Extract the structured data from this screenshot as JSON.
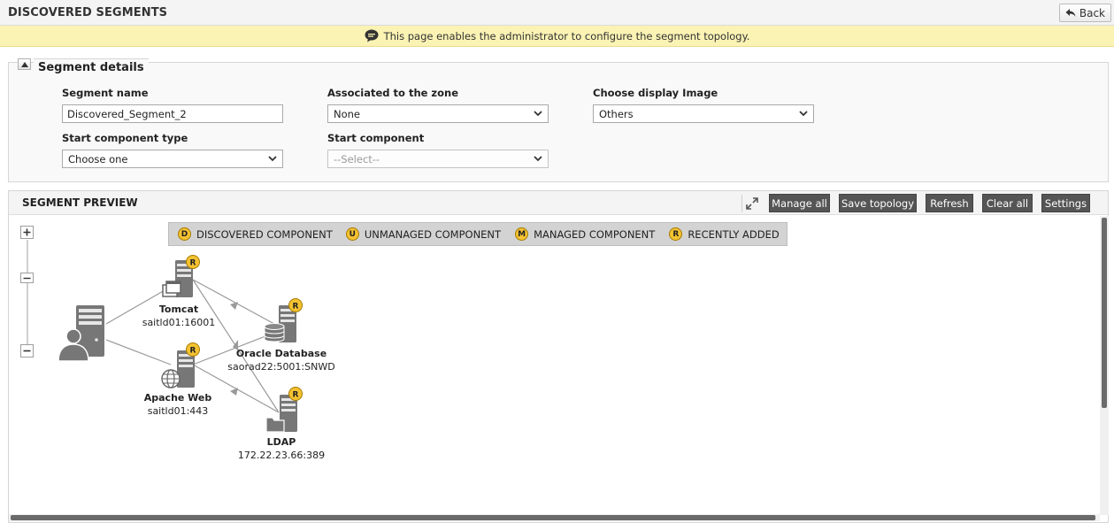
{
  "header": {
    "title": "DISCOVERED SEGMENTS",
    "back_label": "Back"
  },
  "banner": {
    "message": "This page enables the administrator to configure the segment topology."
  },
  "details": {
    "legend": "Segment details",
    "segment_name_label": "Segment name",
    "segment_name_value": "Discovered_Segment_2",
    "zone_label": "Associated to the zone",
    "zone_value": "None",
    "display_image_label": "Choose display Image",
    "display_image_value": "Others",
    "start_type_label": "Start component type",
    "start_type_value": "Choose one",
    "start_component_label": "Start component",
    "start_component_value": "--Select--"
  },
  "preview": {
    "title": "SEGMENT PREVIEW",
    "buttons": {
      "manage_all": "Manage all",
      "save_topology": "Save topology",
      "refresh": "Refresh",
      "clear_all": "Clear all",
      "settings": "Settings"
    },
    "legend": [
      {
        "badge": "D",
        "label": "DISCOVERED COMPONENT"
      },
      {
        "badge": "U",
        "label": "UNMANAGED COMPONENT"
      },
      {
        "badge": "M",
        "label": "MANAGED COMPONENT"
      },
      {
        "badge": "R",
        "label": "RECENTLY ADDED"
      }
    ],
    "nodes": {
      "tomcat": {
        "name": "Tomcat",
        "address": "saitld01:16001",
        "badge": "R"
      },
      "oracle": {
        "name": "Oracle Database",
        "address": "saorad22:5001:SNWD",
        "badge": "R"
      },
      "apache": {
        "name": "Apache Web",
        "address": "saitld01:443",
        "badge": "R"
      },
      "ldap": {
        "name": "LDAP",
        "address": "172.22.23.66:389",
        "badge": "R"
      }
    }
  },
  "colors": {
    "banner_bg": "#fbf3b4",
    "button_bg": "#555555",
    "badge_bg": "#f4c231",
    "icon_gray": "#7a7a7a"
  }
}
